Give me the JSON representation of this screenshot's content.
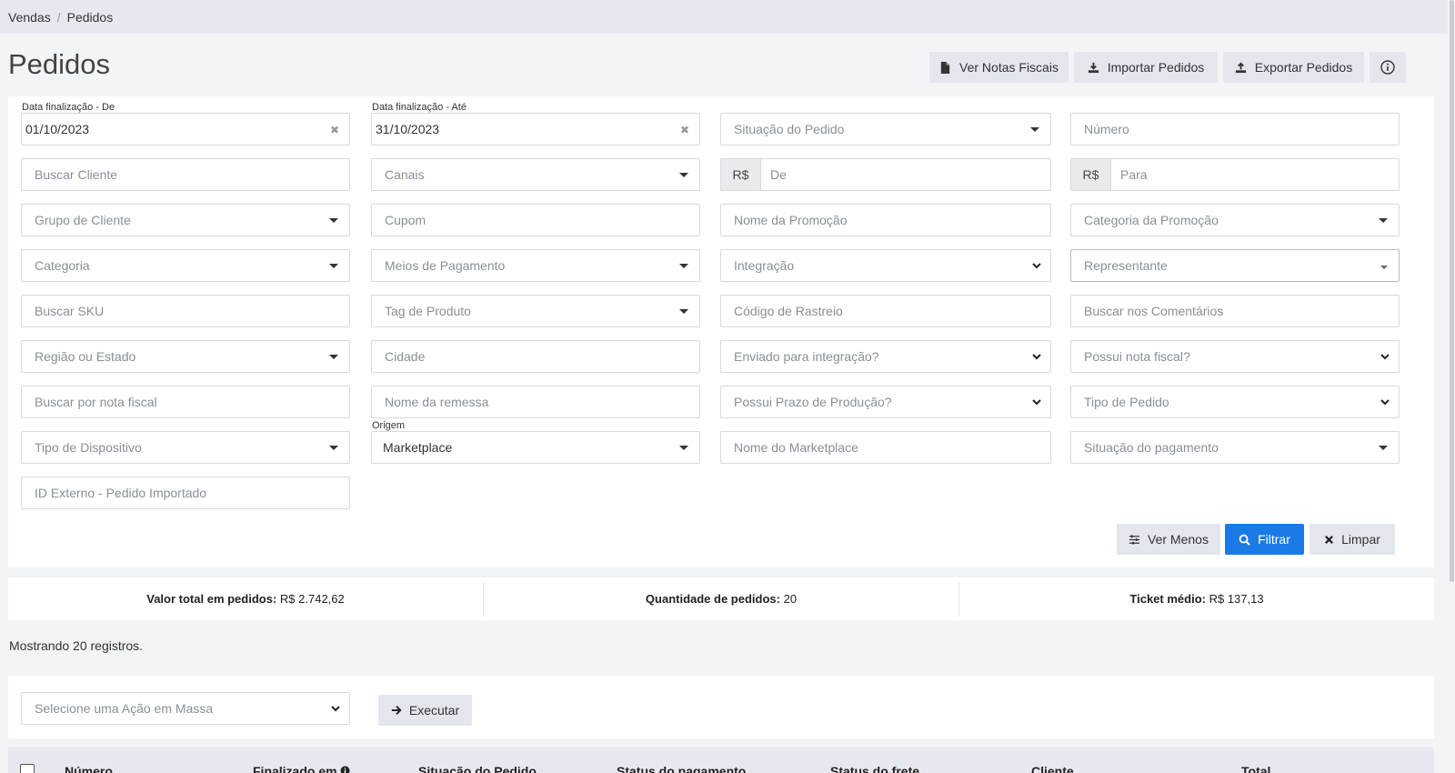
{
  "breadcrumb": {
    "items": [
      "Vendas",
      "Pedidos"
    ]
  },
  "page": {
    "title": "Pedidos"
  },
  "header_buttons": {
    "notas": "Ver Notas Fiscais",
    "importar": "Importar Pedidos",
    "exportar": "Exportar Pedidos"
  },
  "filters": {
    "data_de": {
      "label": "Data finalização - De",
      "value": "01/10/2023"
    },
    "data_ate": {
      "label": "Data finalização - Até",
      "value": "31/10/2023"
    },
    "situacao_pedido": "Situação do Pedido",
    "numero": "Número",
    "buscar_cliente": "Buscar Cliente",
    "canais": "Canais",
    "currency_prefix": "R$",
    "valor_de": "De",
    "valor_para": "Para",
    "grupo_cliente": "Grupo de Cliente",
    "cupom": "Cupom",
    "nome_promocao": "Nome da Promoção",
    "categoria_promocao": "Categoria da Promoção",
    "categoria": "Categoria",
    "meios_pagamento": "Meios de Pagamento",
    "integracao": "Integração",
    "representante": "Representante",
    "buscar_sku": "Buscar SKU",
    "tag_produto": "Tag de Produto",
    "codigo_rastreio": "Código de Rastreio",
    "buscar_comentarios": "Buscar nos Comentários",
    "regiao_estado": "Região ou Estado",
    "cidade": "Cidade",
    "enviado_integracao": "Enviado para integração?",
    "possui_nota": "Possui nota fiscal?",
    "buscar_nota": "Buscar por nota fiscal",
    "nome_remessa": "Nome da remessa",
    "prazo_producao": "Possui Prazo de Produção?",
    "tipo_pedido": "Tipo de Pedido",
    "tipo_dispositivo": "Tipo de Dispositivo",
    "origem": {
      "label": "Origem",
      "value": "Marketplace"
    },
    "nome_marketplace": "Nome do Marketplace",
    "situacao_pagamento": "Situação do pagamento",
    "id_externo": "ID Externo - Pedido Importado"
  },
  "actions": {
    "ver_menos": "Ver Menos",
    "filtrar": "Filtrar",
    "limpar": "Limpar"
  },
  "stats": {
    "total_label": "Valor total em pedidos:",
    "total_value": "R$ 2.742,62",
    "qty_label": "Quantidade de pedidos:",
    "qty_value": "20",
    "ticket_label": "Ticket médio:",
    "ticket_value": "R$ 137,13"
  },
  "records_text": "Mostrando 20 registros.",
  "bulk": {
    "placeholder": "Selecione uma Ação em Massa",
    "execute": "Executar"
  },
  "table": {
    "columns": [
      "Número",
      "Finalizado em",
      "Situação do Pedido",
      "Status do pagamento",
      "Status do frete",
      "Cliente",
      "Total"
    ]
  },
  "colors": {
    "primary": "#1a7be6",
    "button_gray": "#e3e7ed",
    "breadcrumb_bg": "#e5e9ef"
  }
}
